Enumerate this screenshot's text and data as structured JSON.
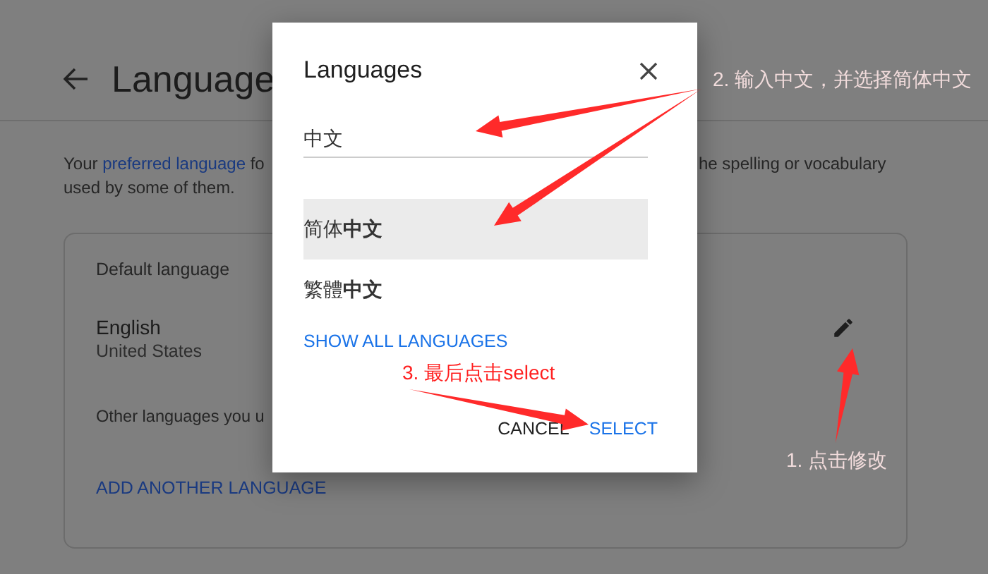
{
  "page": {
    "title": "Language",
    "description": {
      "before_link": "Your ",
      "link": "preferred language",
      "after_link": " fo",
      "right_fragment": "he spelling or vocabulary",
      "line_2": "used by some of them."
    },
    "card": {
      "default_label": "Default language",
      "language": "English",
      "region": "United States",
      "other_label": "Other languages you u",
      "add_link": "ADD ANOTHER LANGUAGE"
    }
  },
  "dialog": {
    "title": "Languages",
    "search_value": "中文",
    "options": [
      {
        "label": "简体**中文**",
        "selected": true
      },
      {
        "label": "繁體**中文**",
        "selected": false
      }
    ],
    "show_all": "SHOW ALL LANGUAGES",
    "buttons": [
      {
        "label": "CANCEL",
        "kind": "secondary"
      },
      {
        "label": "SELECT",
        "kind": "primary"
      }
    ]
  },
  "annotations": [
    {
      "text": "2. 输入中文，并选择简体中文",
      "color": "#f2dcdc"
    },
    {
      "text": "3. 最后点击select",
      "color": "#ff1f1f"
    },
    {
      "text": "1. 点击修改",
      "color": "#f2dcdc"
    }
  ]
}
